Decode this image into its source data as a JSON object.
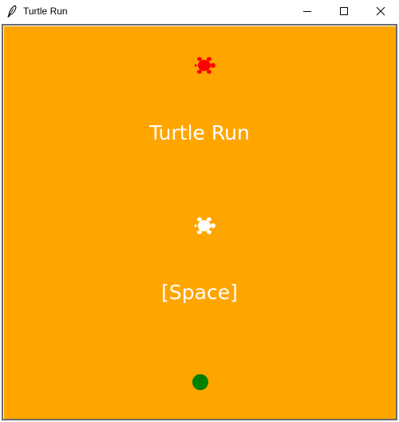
{
  "window": {
    "title": "Turtle Run",
    "app_icon": "feather-icon",
    "controls": {
      "minimize_icon": "minimize-icon",
      "maximize_icon": "maximize-icon",
      "close_icon": "close-icon"
    }
  },
  "canvas": {
    "background_color": "#ffa500",
    "title_text": "Turtle Run",
    "hint_text": "[Space]"
  },
  "sprites": {
    "enemy_turtle": {
      "icon": "turtle-icon",
      "color": "#ff0000"
    },
    "player_turtle": {
      "icon": "turtle-icon",
      "color": "#ffffff"
    },
    "goal": {
      "icon": "circle-icon",
      "color": "#008000"
    }
  }
}
